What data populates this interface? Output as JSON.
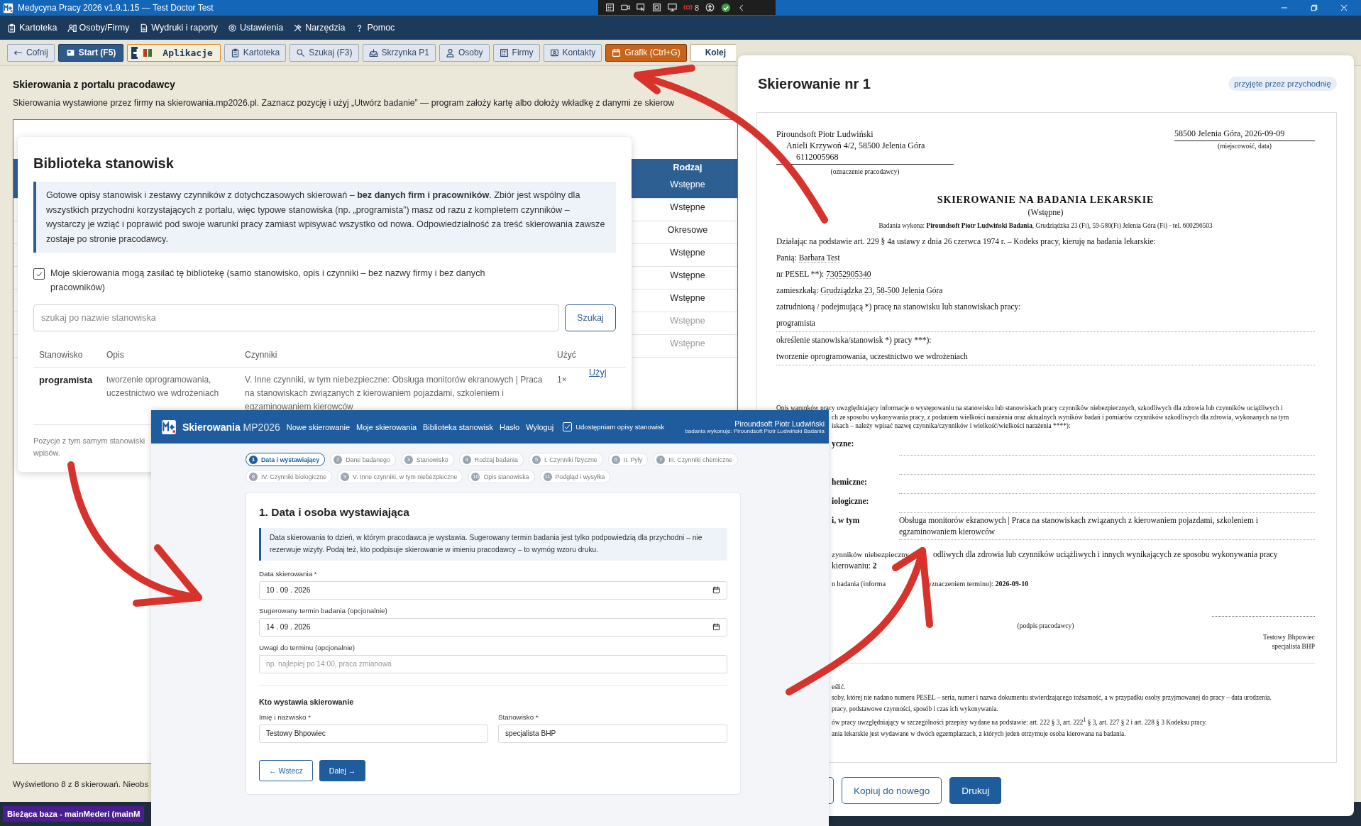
{
  "window": {
    "title": "Medycyna Pracy 2026 v1.9.1.15 — Test Doctor Test",
    "recorder_count": "8"
  },
  "menu": [
    {
      "label": "Kartoteka"
    },
    {
      "label": "Osoby/Firmy"
    },
    {
      "label": "Wydruki i raporty"
    },
    {
      "label": "Ustawienia"
    },
    {
      "label": "Narzędzia"
    },
    {
      "label": "Pomoc"
    }
  ],
  "toolbar": [
    {
      "kind": "back",
      "label": "Cofnij"
    },
    {
      "kind": "primary",
      "label": "Start (F5)"
    },
    {
      "kind": "apps",
      "label": "Aplikacje"
    },
    {
      "kind": "plain",
      "label": "Kartoteka"
    },
    {
      "kind": "plain",
      "label": "Szukaj (F3)"
    },
    {
      "kind": "plain",
      "label": "Skrzynka P1"
    },
    {
      "kind": "plain",
      "label": "Osoby"
    },
    {
      "kind": "plain",
      "label": "Firmy"
    },
    {
      "kind": "plain",
      "label": "Kontakty"
    },
    {
      "kind": "accent",
      "label": "Grafik (Ctrl+G)"
    },
    {
      "kind": "field",
      "label": "Kolej"
    }
  ],
  "main": {
    "heading": "Skierowania z portalu pracodawcy",
    "description": "Skierowania wystawione przez firmy na skierowania.mp2026.pl. Zaznacz pozycję i użyj „Utwórz badanie” — program założy kartę albo dołoży wkładkę z danymi ze skierow",
    "table": {
      "column": "Rodzaj",
      "rows": [
        {
          "value": "Wstępne",
          "selected": true,
          "dimmed": false
        },
        {
          "value": "Wstępne",
          "selected": false,
          "dimmed": false
        },
        {
          "value": "Okresowe",
          "selected": false,
          "dimmed": false
        },
        {
          "value": "Wstępne",
          "selected": false,
          "dimmed": false
        },
        {
          "value": "Wstępne",
          "selected": false,
          "dimmed": false
        },
        {
          "value": "Wstępne",
          "selected": false,
          "dimmed": false
        },
        {
          "value": "Wstępne",
          "selected": false,
          "dimmed": true
        },
        {
          "value": "Wstępne",
          "selected": false,
          "dimmed": true
        }
      ]
    },
    "footer": "Wyświetlono 8 z 8 skierowań. Nieobs"
  },
  "status_bar": {
    "database": "Bieżąca baza - mainMederi (mainM"
  },
  "library_dialog": {
    "title": "Biblioteka stanowisk",
    "info": "Gotowe opisy stanowisk i zestawy czynników z dotychczasowych skierowań – **bez danych firm i pracowników**. Zbiór jest wspólny dla wszystkich przychodni korzystających z portalu, więc typowe stanowiska (np. „programista”) masz od razu z kompletem czynników – wystarczy je wziąć i poprawić pod swoje warunki pracy zamiast wpisywać wszystko od nowa. Odpowiedzialność za treść skierowania zawsze zostaje po stronie pracodawcy.",
    "share_checkbox": {
      "label": "Moje skierowania mogą zasilać tę bibliotekę (samo stanowisko, opis i czynniki – bez nazwy firmy i bez danych pracowników)",
      "checked": true
    },
    "search": {
      "placeholder": "szukaj po nazwie stanowiska",
      "button": "Szukaj"
    },
    "columns": [
      "Stanowisko",
      "Opis",
      "Czynniki",
      "Użyć"
    ],
    "rows": [
      {
        "position": "programista",
        "description": "tworzenie oprogramowania, uczestnictwo we wdrożeniach",
        "factors": "V. Inne czynniki, w tym niebezpieczne: Obsługa monitorów ekranowych | Praca na stanowiskach związanych z kierowaniem pojazdami, szkoleniem i egzaminowaniem kierowców",
        "uses": "1×",
        "action": "Użyj"
      }
    ],
    "note_lines": [
      "Pozycje z tym samym stanowiski",
      "wpisów."
    ]
  },
  "referral_panel": {
    "title": "Skierowanie nr 1",
    "status": "przyjęte przez przychodnię",
    "document": {
      "employer_lines": [
        "Piroundsoft Piotr Ludwiński",
        "Anieli Krzywoń 4/2, 58500 Jelenia Góra",
        "6112005968"
      ],
      "employer_caption": "(oznaczenie pracodawcy)",
      "place_date": "58500 Jelenia Góra, 2026-09-09",
      "place_date_caption": "(miejscowość, data)",
      "title": "SKIEROWANIE NA BADANIA LEKARSKIE",
      "subtitle": "(Wstępne)",
      "performer": "Badania wykona: **Piroundsoft Piotr Ludwiński Badania**, Grudziądzka 23 (Fi), 59-580(Fi) Jelenia Góra (Fi) · tel. 600296503",
      "intro": "Działając na podstawie art. 229 § 4a ustawy z dnia 26 czerwca 1974 r. – Kodeks pracy, kieruję na badania lekarskie:",
      "person_fields": [
        {
          "label": "Panią:",
          "value": "Barbara Test"
        },
        {
          "label": "nr PESEL **):",
          "value": "73052905340"
        },
        {
          "label": "zamieszkałą:",
          "value": "Grudziądzka 23, 58-500 Jelenia Góra"
        }
      ],
      "employment_label": "zatrudnioną / podejmującą *) pracę na stanowisku lub stanowiskach pracy:",
      "position": "programista",
      "position_desc_label": "określenie stanowiska/stanowisk *) pracy ***):",
      "position_desc": "tworzenie oprogramowania, uczestnictwo we wdrożeniach",
      "conditions_lines": [
        "Opis warunków pracy uwzględniający informacje o występowaniu na stanowisku lub stanowiskach pracy czynników niebezpiecznych, szkodliwych dla zdrowia lub czynników uciążliwych i",
        "ch ze sposobu wykonywania pracy, z podaniem wielkości narażenia oraz aktualnych wyników badań i pomiarów czynników szkodliwych dla zdrowia, wykonanych na tym",
        "iskach – należy wpisać nazwę czynnika/czynników i wielkość/wielkości narażenia ****):"
      ],
      "factors": [
        {
          "kind": "row",
          "label": "yczne:"
        },
        {
          "kind": "empty"
        },
        {
          "kind": "row",
          "label": "hemiczne:"
        },
        {
          "kind": "row",
          "label": "iologiczne:"
        },
        {
          "kind": "row",
          "label": "i, w tym",
          "value": "Obsługa monitorów ekranowych | Praca na stanowiskach związanych z kierowaniem pojazdami, szkoleniem i egzaminowaniem kierowców"
        }
      ],
      "count_line_parts": [
        "zynników niebezpieczny",
        "odliwych dla zdrowia lub czynników uciążliwych i innych wynikających ze sposobu wykonywania pracy"
      ],
      "count_line_end": "kierowaniu: **2**",
      "term_parts": [
        "n badania (informa",
        "yznaczeniem terminu): **2026-09-10**"
      ],
      "signature_caption": "(podpis pracodawcy)",
      "signer_name": "Testowy Bhpowiec",
      "signer_role": "specjalista BHP",
      "footnotes": [
        "eślić.",
        "soby, której nie nadano numeru PESEL – seria, numer i nazwa dokumentu stwierdzającego tożsamość, a w przypadku osoby przyjmowanej do pracy – data urodzenia.",
        "pracy, podstawowe czynności, sposób i czas ich wykonywania.",
        "ów pracy uwzględniający w szczególności przepisy wydane na podstawie: art. 222 § 3, art. 222$^{1}$ § 3, art. 227 § 2 i art. 228 § 3 Kodeksu pracy.",
        "ania lekarskie jest wydawane w dwóch egzemplarzach, z których jeden otrzymuje osoba kierowana na badania."
      ]
    },
    "buttons": [
      "Kopiuj do nowego",
      "Drukuj"
    ]
  },
  "portal": {
    "brand": "Skierowania",
    "brand_suffix": "MP2026",
    "nav": [
      "Nowe skierowanie",
      "Moje skierowania",
      "Biblioteka stanowisk",
      "Hasło",
      "Wyloguj"
    ],
    "share": {
      "label": "Udostępniam opisy stanowisk",
      "checked": true
    },
    "user": "Piroundsoft Piotr Ludwiński",
    "performer": "badania wykonuje: Piroundsoft Piotr Ludwiński Badania",
    "steps": [
      {
        "number": "1",
        "label": "Data i wystawiający",
        "selected": true
      },
      {
        "number": "2",
        "label": "Dane badanego",
        "selected": false
      },
      {
        "number": "3",
        "label": "Stanowisko",
        "selected": false
      },
      {
        "number": "4",
        "label": "Rodzaj badania",
        "selected": false
      },
      {
        "number": "5",
        "label": "I. Czynniki fizyczne",
        "selected": false
      },
      {
        "number": "6",
        "label": "II. Pyły",
        "selected": false
      },
      {
        "number": "7",
        "label": "III. Czynniki chemiczne",
        "selected": false
      },
      {
        "number": "8",
        "label": "IV. Czynniki biologiczne",
        "selected": false
      },
      {
        "number": "9",
        "label": "V. Inne czynniki, w tym niebezpieczne",
        "selected": false
      },
      {
        "number": "10",
        "label": "Opis stanowiska",
        "selected": false
      },
      {
        "number": "11",
        "label": "Podgląd i wysyłka",
        "selected": false
      }
    ],
    "form": {
      "title": "1. Data i osoba wystawiająca",
      "info": "Data skierowania to dzień, w którym pracodawca je wystawia. Sugerowany termin badania jest tylko podpowiedzią dla przychodni – nie rezerwuje wizyty. Podaj też, kto podpisuje skierowanie w imieniu pracodawcy – to wymóg wzoru druku.",
      "fields": [
        {
          "kind": "date",
          "label": "Data skierowania *",
          "value": "10 . 09 . 2026"
        },
        {
          "kind": "date",
          "label": "Sugerowany termin badania (opcjonalnie)",
          "value": "14 . 09 . 2026"
        },
        {
          "kind": "text",
          "label": "Uwagi do terminu (opcjonalnie)",
          "placeholder": "np. najlepiej po 14:00, praca zmianowa"
        }
      ],
      "issuer_heading": "Kto wystawia skierowanie",
      "issuer_fields": [
        {
          "label": "Imię i nazwisko *",
          "value": "Testowy Bhpowiec"
        },
        {
          "label": "Stanowisko *",
          "value": "specjalista BHP"
        }
      ],
      "back": "← Wstecz",
      "next": "Dalej →"
    }
  }
}
